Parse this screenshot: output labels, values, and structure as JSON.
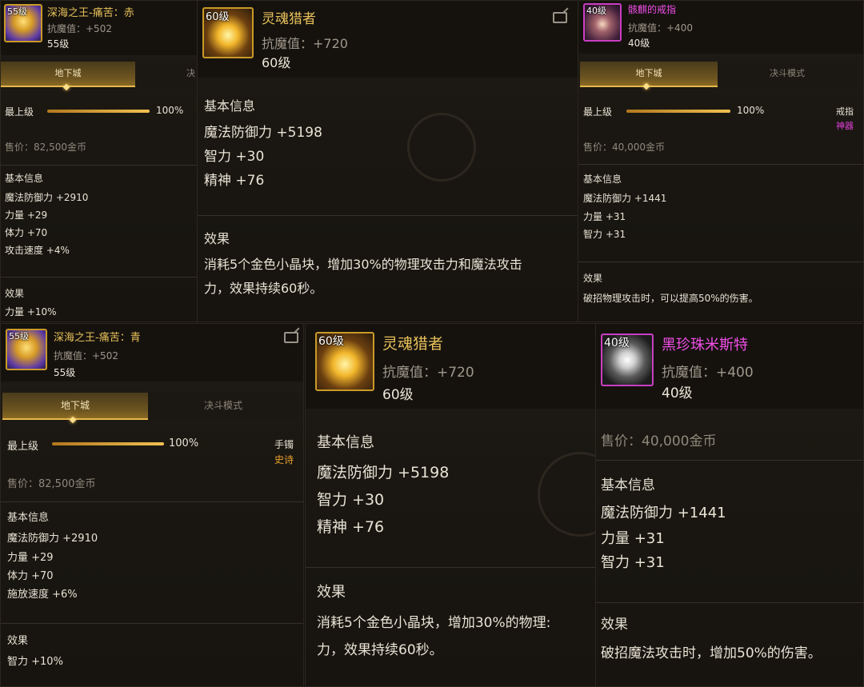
{
  "panel_a": {
    "level": "55级",
    "name": "深海之王-痛苦：赤",
    "resist": "抗魔值：+502",
    "level_text": "55级",
    "tab_active": "地下城",
    "tab_inactive": "决",
    "grade_label": "最上级",
    "grade_percent": "100%",
    "grade_fill": 1.0,
    "price": "售价：82,500金币",
    "basic_title": "基本信息",
    "stats": [
      "魔法防御力 +2910",
      "力量 +29",
      "体力 +70",
      "攻击速度 +4%"
    ],
    "effect_title": "效果",
    "effect": "力量 +10%"
  },
  "panel_b": {
    "level": "60级",
    "name": "灵魂猎者",
    "resist": "抗魔值：+720",
    "level_text": "60级",
    "basic_title": "基本信息",
    "stats": [
      "魔法防御力 +5198",
      "智力 +30",
      "精神 +76"
    ],
    "effect_title": "效果",
    "effect_line1": "消耗5个金色小晶块，增加30%的物理攻击力和魔法攻击",
    "effect_line2": "力，效果持续60秒。"
  },
  "panel_c": {
    "level": "40级",
    "name": "骸麒的戒指",
    "resist": "抗魔值：+400",
    "level_text": "40级",
    "tab_active": "地下城",
    "tab_inactive": "决斗模式",
    "grade_label": "最上级",
    "grade_percent": "100%",
    "grade_fill": 1.0,
    "item_type": "戒指",
    "rarity": "神器",
    "price": "售价：40,000金币",
    "basic_title": "基本信息",
    "stats": [
      "魔法防御力 +1441",
      "力量 +31",
      "智力 +31"
    ],
    "effect_title": "效果",
    "effect": "破招物理攻击时，可以提高50%的伤害。"
  },
  "panel_d": {
    "level": "55级",
    "name": "深海之王-痛苦：青",
    "resist": "抗魔值：+502",
    "level_text": "55级",
    "tab_active": "地下城",
    "tab_inactive": "决斗模式",
    "grade_label": "最上级",
    "grade_percent": "100%",
    "grade_fill": 1.0,
    "item_type": "手镯",
    "rarity": "史诗",
    "price": "售价：82,500金币",
    "basic_title": "基本信息",
    "stats": [
      "魔法防御力 +2910",
      "力量 +29",
      "体力 +70",
      "施放速度 +6%"
    ],
    "effect_title": "效果",
    "effect": "智力 +10%"
  },
  "panel_e": {
    "level": "60级",
    "name": "灵魂猎者",
    "resist": "抗魔值：+720",
    "level_text": "60级",
    "basic_title": "基本信息",
    "stats": [
      "魔法防御力 +5198",
      "智力 +30",
      "精神 +76"
    ],
    "effect_title": "效果",
    "effect_line1": "消耗5个金色小晶块，增加30%的物理:",
    "effect_line2": "力，效果持续60秒。"
  },
  "panel_f": {
    "level": "40级",
    "name": "黑珍珠米斯特",
    "resist": "抗魔值：+400",
    "level_text": "40级",
    "price": "售价：40,000金币",
    "basic_title": "基本信息",
    "stats": [
      "魔法防御力 +1441",
      "力量 +31",
      "智力 +31"
    ],
    "effect_title": "效果",
    "effect": "破招魔法攻击时，增加50%的伤害。"
  }
}
